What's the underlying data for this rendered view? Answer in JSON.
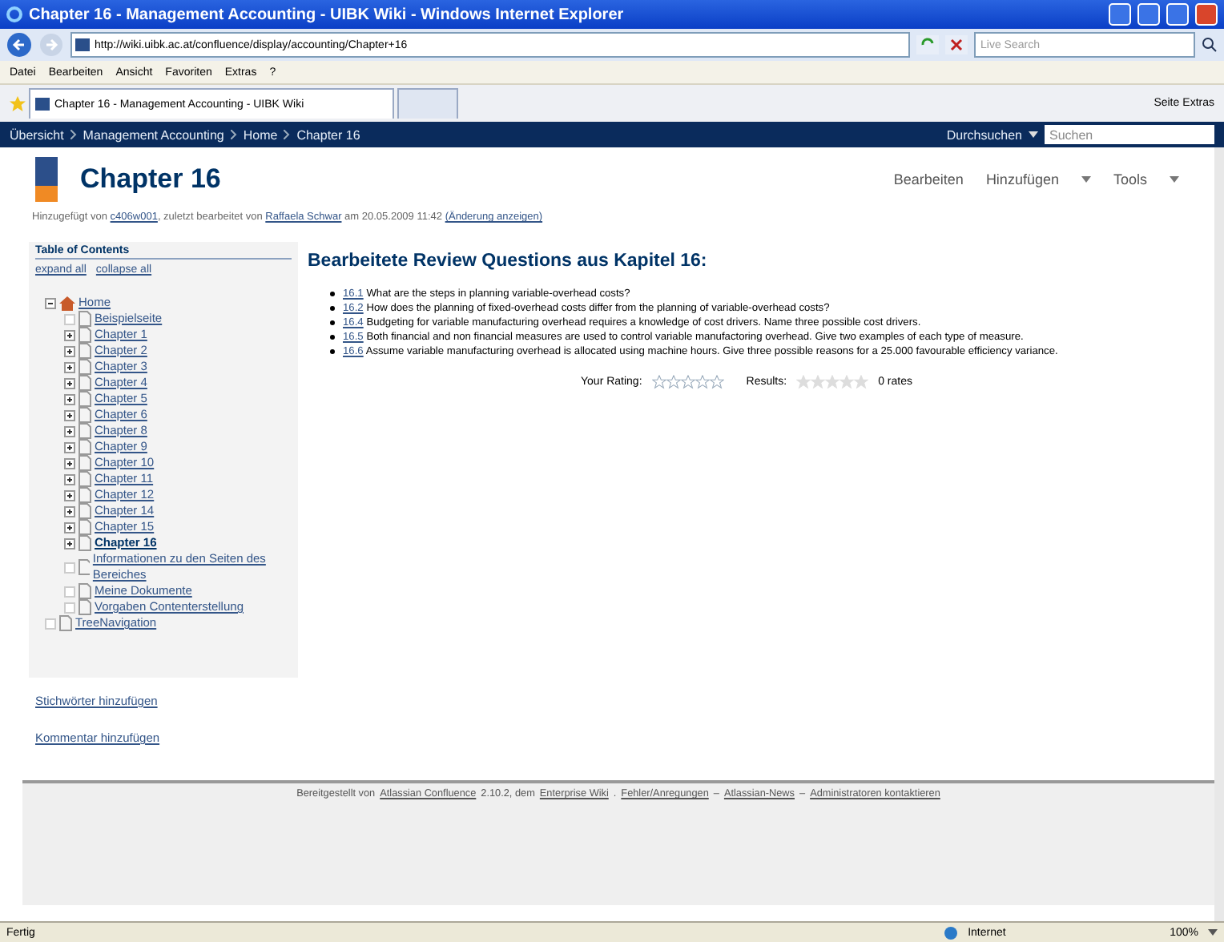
{
  "window": {
    "title": "Chapter 16 - Management Accounting - UIBK Wiki - Windows Internet Explorer"
  },
  "address_bar": {
    "url": "http://wiki.uibk.ac.at/confluence/display/accounting/Chapter+16",
    "search_placeholder": "Live Search"
  },
  "menu": [
    "Datei",
    "Bearbeiten",
    "Ansicht",
    "Favoriten",
    "Extras",
    "?"
  ],
  "browser_tabs": [
    {
      "label": "Chapter 16 - Management Accounting - UIBK Wiki",
      "selected": true
    },
    {
      "selected": false
    }
  ],
  "command_bar": [
    "Seite",
    "Extras"
  ],
  "breadcrumb": [
    "Übersicht",
    "Management Accounting",
    "Home",
    "Chapter 16"
  ],
  "site_search": {
    "label": "Durchsuchen",
    "placeholder": "Suchen"
  },
  "page": {
    "title": "Chapter 16",
    "actions": [
      "Bearbeiten",
      "Hinzufügen",
      "Tools"
    ],
    "meta": {
      "prefix": "Hinzugefügt von",
      "creator": "c406w001",
      "middle": ", zuletzt bearbeitet von",
      "editor": "Raffaela Schwar",
      "date": "am 20.05.2009 11:42",
      "changes": "(Änderung anzeigen)"
    }
  },
  "toc": {
    "title": "Table of Contents",
    "expand": "expand all",
    "collapse": "collapse all",
    "tree": [
      {
        "label": "Home",
        "expanded": true,
        "kind": "home",
        "selected": false,
        "children": [
          {
            "label": "Beispielseite",
            "kind": "page",
            "selected": false
          },
          {
            "label": "Chapter 1",
            "expanded": false,
            "kind": "page",
            "selected": false
          },
          {
            "label": "Chapter 2",
            "expanded": false,
            "kind": "page",
            "selected": false
          },
          {
            "label": "Chapter 3",
            "expanded": false,
            "kind": "page",
            "selected": false
          },
          {
            "label": "Chapter 4",
            "expanded": false,
            "kind": "page",
            "selected": false
          },
          {
            "label": "Chapter 5",
            "expanded": false,
            "kind": "page",
            "selected": false
          },
          {
            "label": "Chapter 6",
            "expanded": false,
            "kind": "page",
            "selected": false
          },
          {
            "label": "Chapter 8",
            "expanded": false,
            "kind": "page",
            "selected": false
          },
          {
            "label": "Chapter 9",
            "expanded": false,
            "kind": "page",
            "selected": false
          },
          {
            "label": "Chapter 10",
            "expanded": false,
            "kind": "page",
            "selected": false
          },
          {
            "label": "Chapter 11",
            "expanded": false,
            "kind": "page",
            "selected": false
          },
          {
            "label": "Chapter 12",
            "expanded": false,
            "kind": "page",
            "selected": false
          },
          {
            "label": "Chapter 14",
            "expanded": false,
            "kind": "page",
            "selected": false
          },
          {
            "label": "Chapter 15",
            "expanded": false,
            "kind": "page",
            "selected": false
          },
          {
            "label": "Chapter 16",
            "expanded": false,
            "kind": "page",
            "selected": true
          },
          {
            "label": "Informationen zu den Seiten des Bereiches",
            "kind": "page",
            "selected": false
          },
          {
            "label": "Meine Dokumente",
            "kind": "page",
            "selected": false
          },
          {
            "label": "Vorgaben Contenterstellung",
            "kind": "page",
            "selected": false
          }
        ]
      },
      {
        "label": "TreeNavigation",
        "kind": "page",
        "selected": false
      }
    ]
  },
  "side_links": [
    "Stichwörter hinzufügen",
    "Kommentar hinzufügen"
  ],
  "content": {
    "heading": "Bearbeitete Review Questions aus Kapitel 16:",
    "questions": [
      {
        "link": "16.1",
        "text": "What are the steps in planning variable-overhead costs?"
      },
      {
        "link": "16.2",
        "text": "How does the planning of fixed-overhead costs differ from the planning of variable-overhead costs?"
      },
      {
        "link": "16.4",
        "text": "Budgeting for variable manufacturing overhead requires a knowledge of cost drivers. Name three possible cost drivers."
      },
      {
        "link": "16.5",
        "text": "Both financial and non financial measures are used to control variable manufactoring overhead. Give two examples of each type of measure."
      },
      {
        "link": "16.6",
        "text": "Assume variable manufacturing overhead is allocated using machine hours. Give three possible reasons for a 25.000 favourable efficiency variance."
      }
    ],
    "rating": {
      "label": "Your Rating:",
      "stars": 0
    },
    "results": {
      "label": "Results:",
      "stars": 0,
      "count": "0 rates"
    }
  },
  "footer": [
    {
      "kind": "text",
      "text": "Bereitgestellt von"
    },
    {
      "kind": "link",
      "text": "Atlassian Confluence"
    },
    {
      "kind": "text",
      "text": "2.10.2, dem"
    },
    {
      "kind": "link",
      "text": "Enterprise Wiki"
    },
    {
      "kind": "text",
      "text": "."
    },
    {
      "kind": "link",
      "text": "Fehler/Anregungen"
    },
    {
      "kind": "text",
      "text": "–"
    },
    {
      "kind": "link",
      "text": "Atlassian-News"
    },
    {
      "kind": "text",
      "text": "–"
    },
    {
      "kind": "link",
      "text": "Administratoren kontaktieren"
    }
  ],
  "status_bar": {
    "status": "Fertig",
    "zone": "Internet",
    "zoom": "100%"
  }
}
